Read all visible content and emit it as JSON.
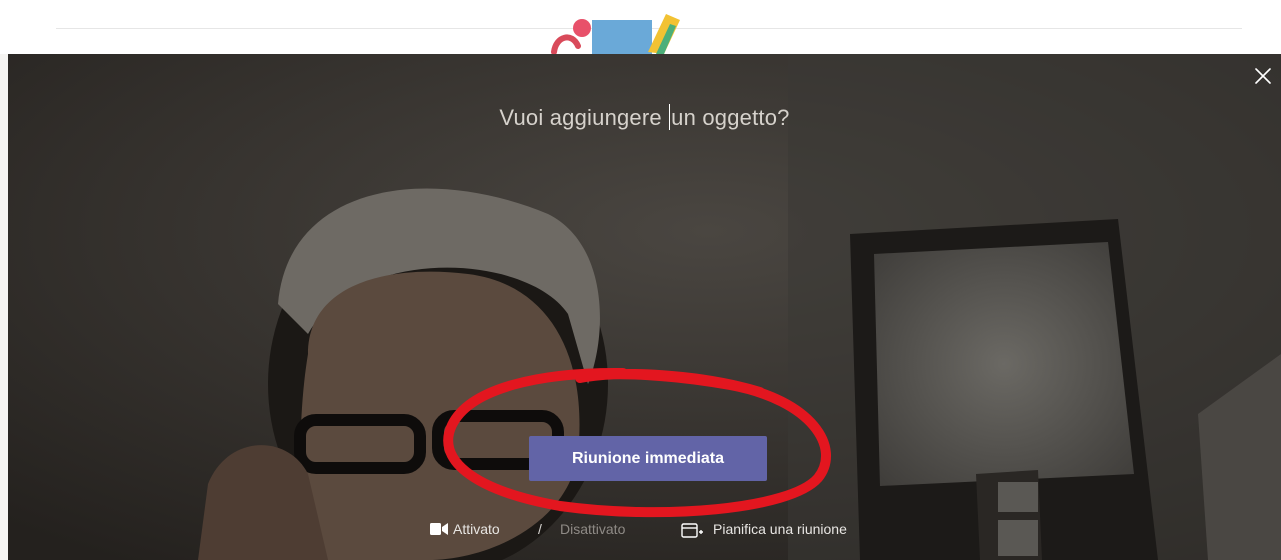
{
  "meeting": {
    "subject_before_caret": "Vuoi aggiungere ",
    "subject_after_caret": "un oggetto?",
    "primary_button_label": "Riunione immediata"
  },
  "video_toggle": {
    "on_label": "Attivato",
    "separator": "/",
    "off_label": "Disattivato",
    "state": "on"
  },
  "schedule": {
    "label": "Pianifica una riunione"
  },
  "icons": {
    "close": "close-icon",
    "camera": "video-camera-icon",
    "schedule": "calendar-add-icon"
  },
  "colors": {
    "primary_button": "#6264a7",
    "annotation_circle": "#e3161f"
  }
}
